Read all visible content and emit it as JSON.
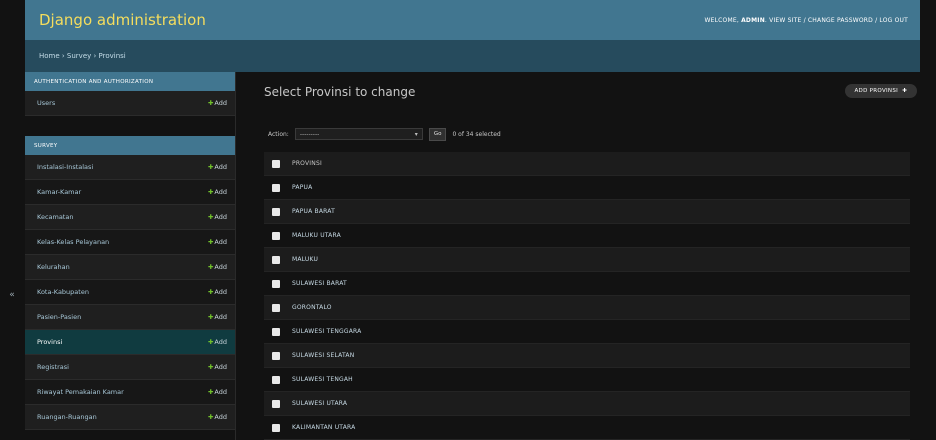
{
  "header": {
    "branding": "Django administration",
    "welcome": "WELCOME,",
    "username": "ADMIN",
    "links": [
      "VIEW SITE",
      "CHANGE PASSWORD",
      "LOG OUT"
    ]
  },
  "breadcrumbs": [
    "Home",
    "Survey",
    "Provinsi"
  ],
  "nav_toggle": "«",
  "sidebar": {
    "groups": [
      {
        "caption": "AUTHENTICATION AND AUTHORIZATION",
        "models": [
          {
            "name": "Users",
            "add": "Add"
          }
        ]
      },
      {
        "caption": "SURVEY",
        "models": [
          {
            "name": "Instalasi-Instalasi",
            "add": "Add"
          },
          {
            "name": "Kamar-Kamar",
            "add": "Add"
          },
          {
            "name": "Kecamatan",
            "add": "Add"
          },
          {
            "name": "Kelas-Kelas Pelayanan",
            "add": "Add"
          },
          {
            "name": "Kelurahan",
            "add": "Add"
          },
          {
            "name": "Kota-Kabupaten",
            "add": "Add"
          },
          {
            "name": "Pasien-Pasien",
            "add": "Add"
          },
          {
            "name": "Provinsi",
            "add": "Add",
            "current": true
          },
          {
            "name": "Registrasi",
            "add": "Add"
          },
          {
            "name": "Riwayat Pemakaian Kamar",
            "add": "Add"
          },
          {
            "name": "Ruangan-Ruangan",
            "add": "Add"
          }
        ]
      }
    ]
  },
  "content": {
    "title": "Select Provinsi to change",
    "add_button": "ADD PROVINSI",
    "action_label": "Action:",
    "action_select_value": "---------",
    "go_button": "Go",
    "selection_count": "0 of 34 selected",
    "column_header": "PROVINSI",
    "rows": [
      "PAPUA",
      "PAPUA BARAT",
      "MALUKU UTARA",
      "MALUKU",
      "SULAWESI BARAT",
      "GORONTALO",
      "SULAWESI TENGGARA",
      "SULAWESI SELATAN",
      "SULAWESI TENGAH",
      "SULAWESI UTARA",
      "KALIMANTAN UTARA"
    ]
  }
}
